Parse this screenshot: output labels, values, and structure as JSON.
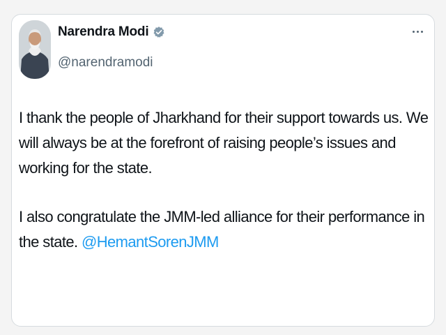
{
  "author": {
    "name": "Narendra Modi",
    "handle": "@narendramodi",
    "verified_color": "#829aab"
  },
  "tweet": {
    "paragraph1": "I thank the people of Jharkhand for their support towards us. We will always be at the forefront of raising people’s issues and working for the state.",
    "paragraph2_text": "I also congratulate the JMM-led alliance for their performance in the state.",
    "mention": "@HemantSorenJMM"
  },
  "colors": {
    "text": "#0f1419",
    "secondary": "#536471",
    "link": "#1d9bf0",
    "border": "#d6dbdf"
  },
  "icons": {
    "avatar": "avatar",
    "verified": "verified-badge-icon",
    "more": "more-options-icon"
  }
}
